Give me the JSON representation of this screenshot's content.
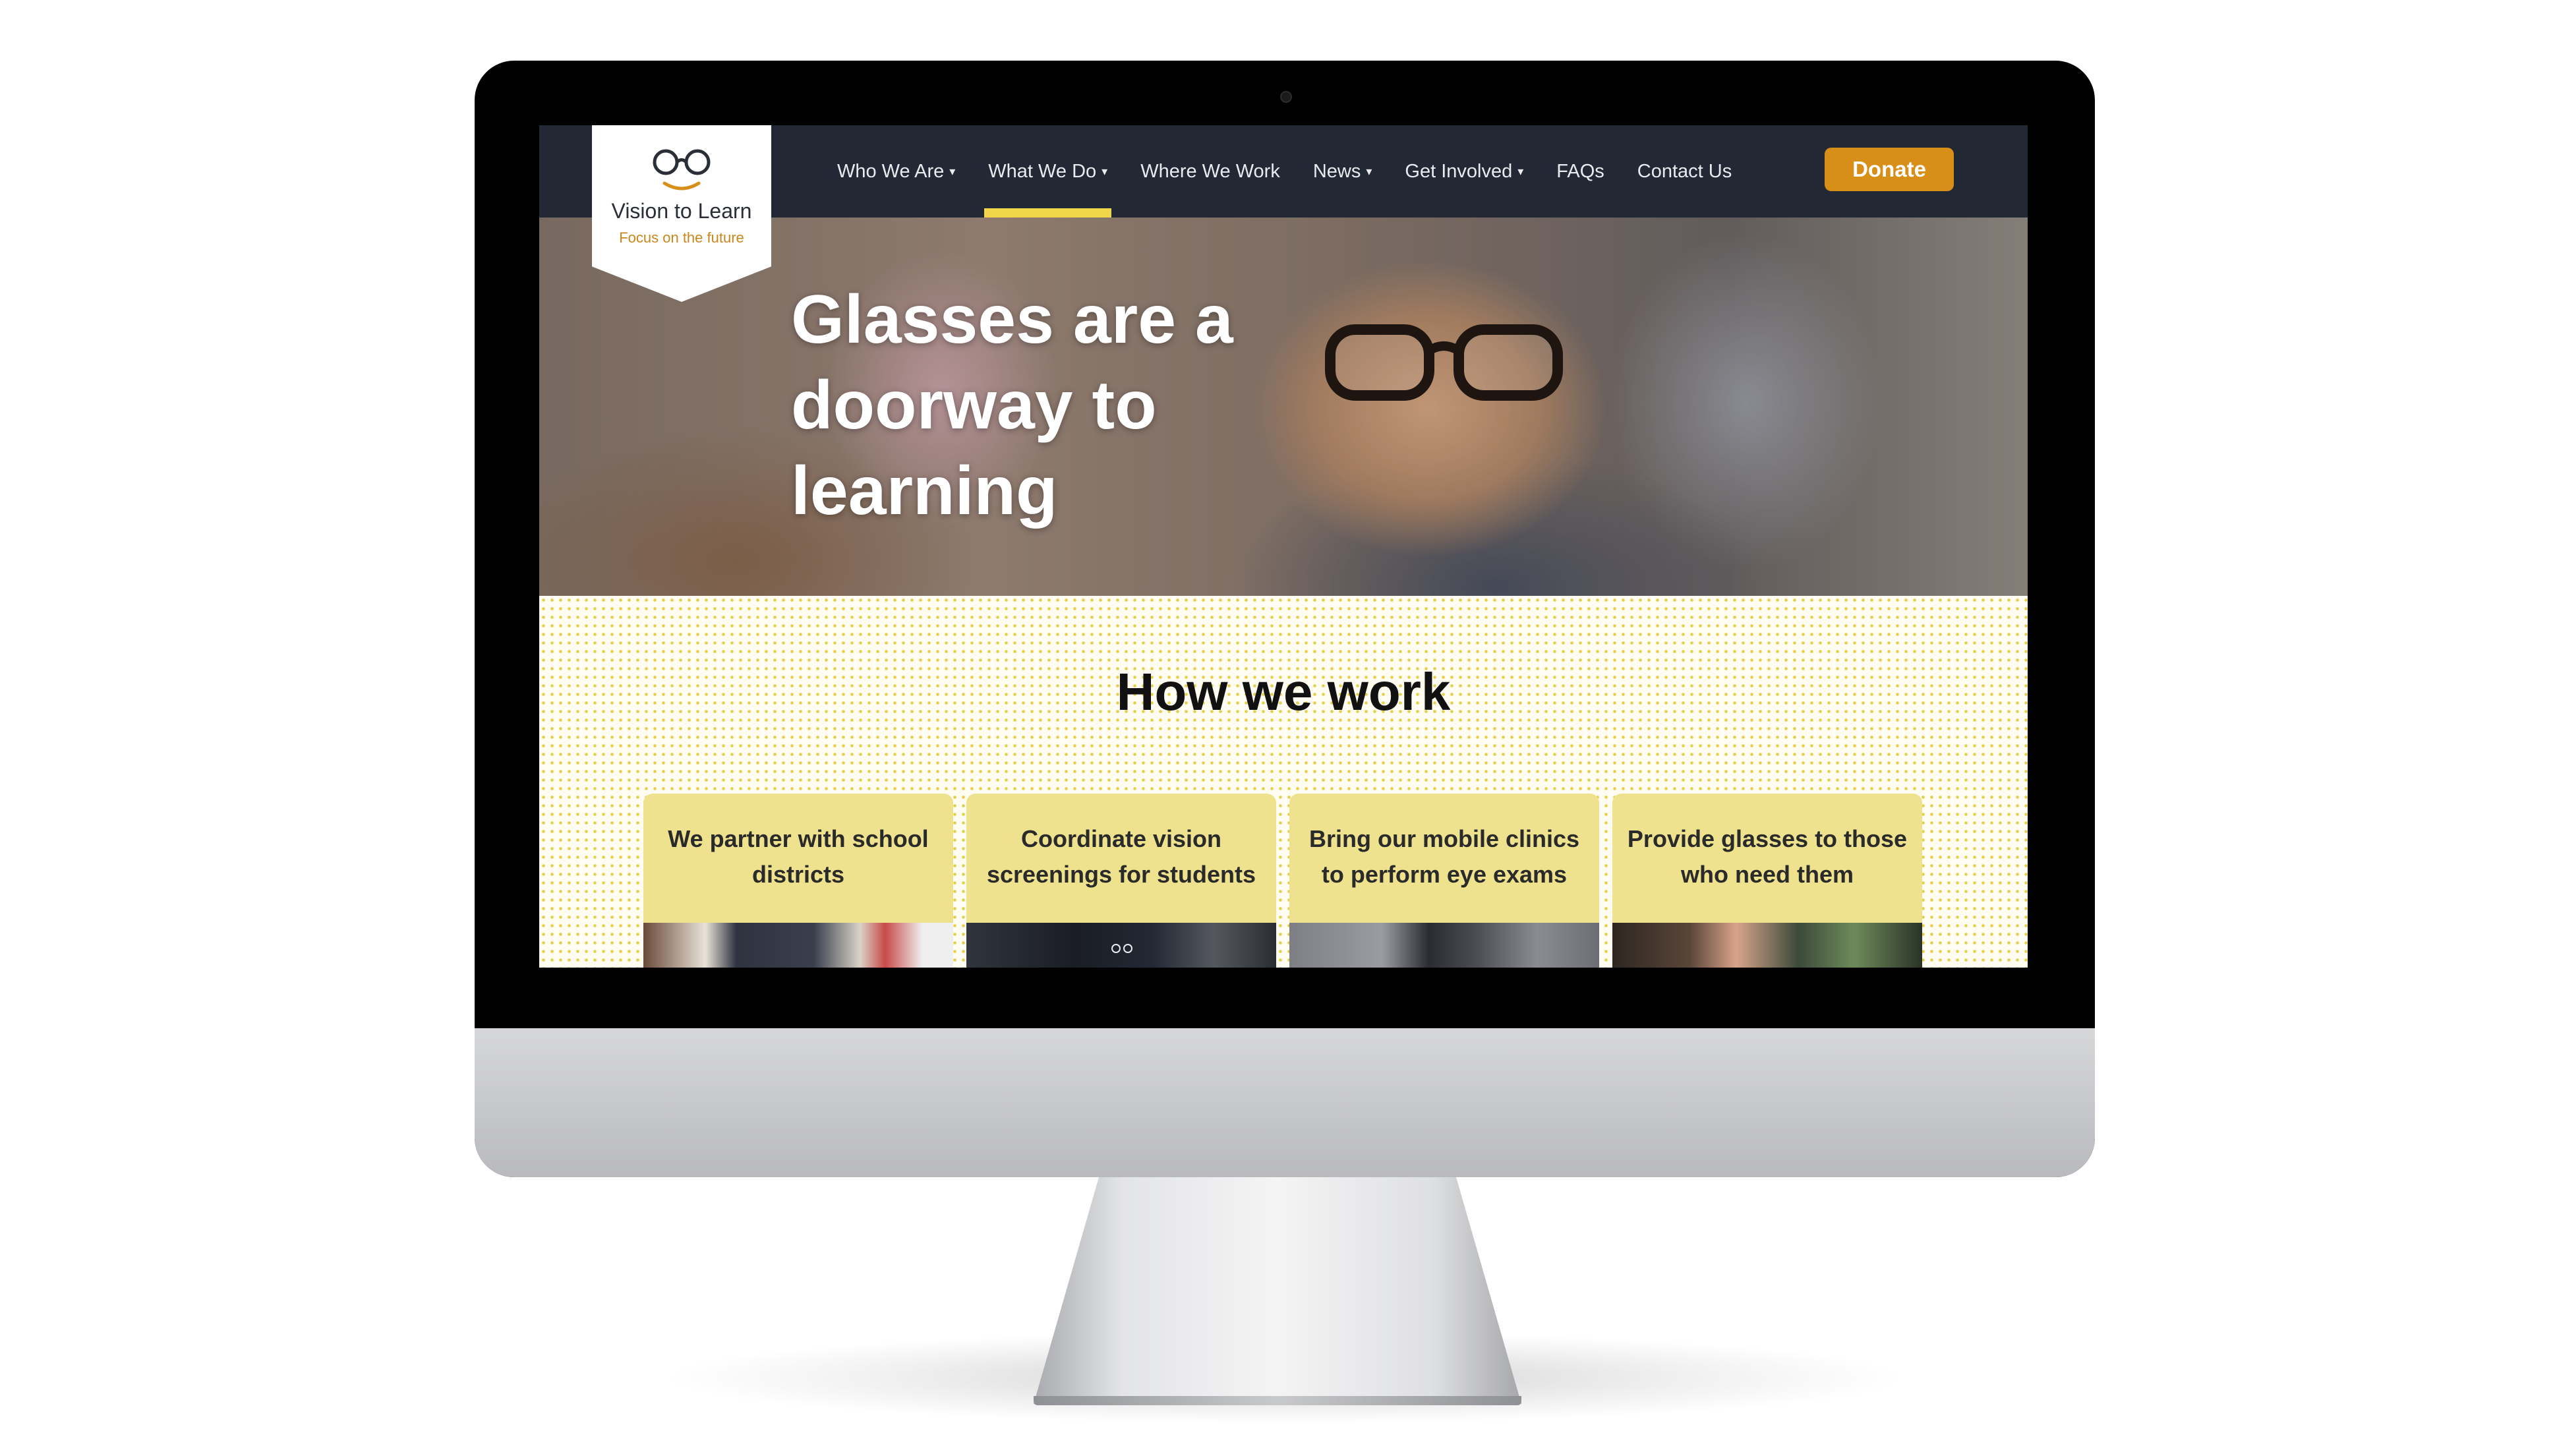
{
  "site": {
    "name": "Vision to Learn",
    "tagline": "Focus on the future"
  },
  "nav": {
    "items": [
      {
        "label": "Who We Are",
        "dropdown": true,
        "active": false
      },
      {
        "label": "What We Do",
        "dropdown": true,
        "active": true
      },
      {
        "label": "Where We Work",
        "dropdown": false,
        "active": false
      },
      {
        "label": "News",
        "dropdown": true,
        "active": false
      },
      {
        "label": "Get Involved",
        "dropdown": true,
        "active": false
      },
      {
        "label": "FAQs",
        "dropdown": false,
        "active": false
      },
      {
        "label": "Contact Us",
        "dropdown": false,
        "active": false
      }
    ],
    "donate_label": "Donate"
  },
  "hero": {
    "title": "Glasses are a doorway to learning"
  },
  "how_we_work": {
    "title": "How we work",
    "cards": [
      {
        "text": "We partner with school districts"
      },
      {
        "text": "Coordinate vision screenings for students"
      },
      {
        "text": "Bring our mobile clinics to perform eye exams"
      },
      {
        "text": "Provide glasses to those who need them"
      }
    ]
  },
  "colors": {
    "nav_bg": "#222834",
    "accent_yellow": "#f1d64c",
    "donate_orange": "#d78f17",
    "card_yellow": "#efe28e",
    "tagline_orange": "#c9871a"
  },
  "icons": {
    "logo": "glasses-smile-icon",
    "dropdown": "chevron-down-icon"
  }
}
